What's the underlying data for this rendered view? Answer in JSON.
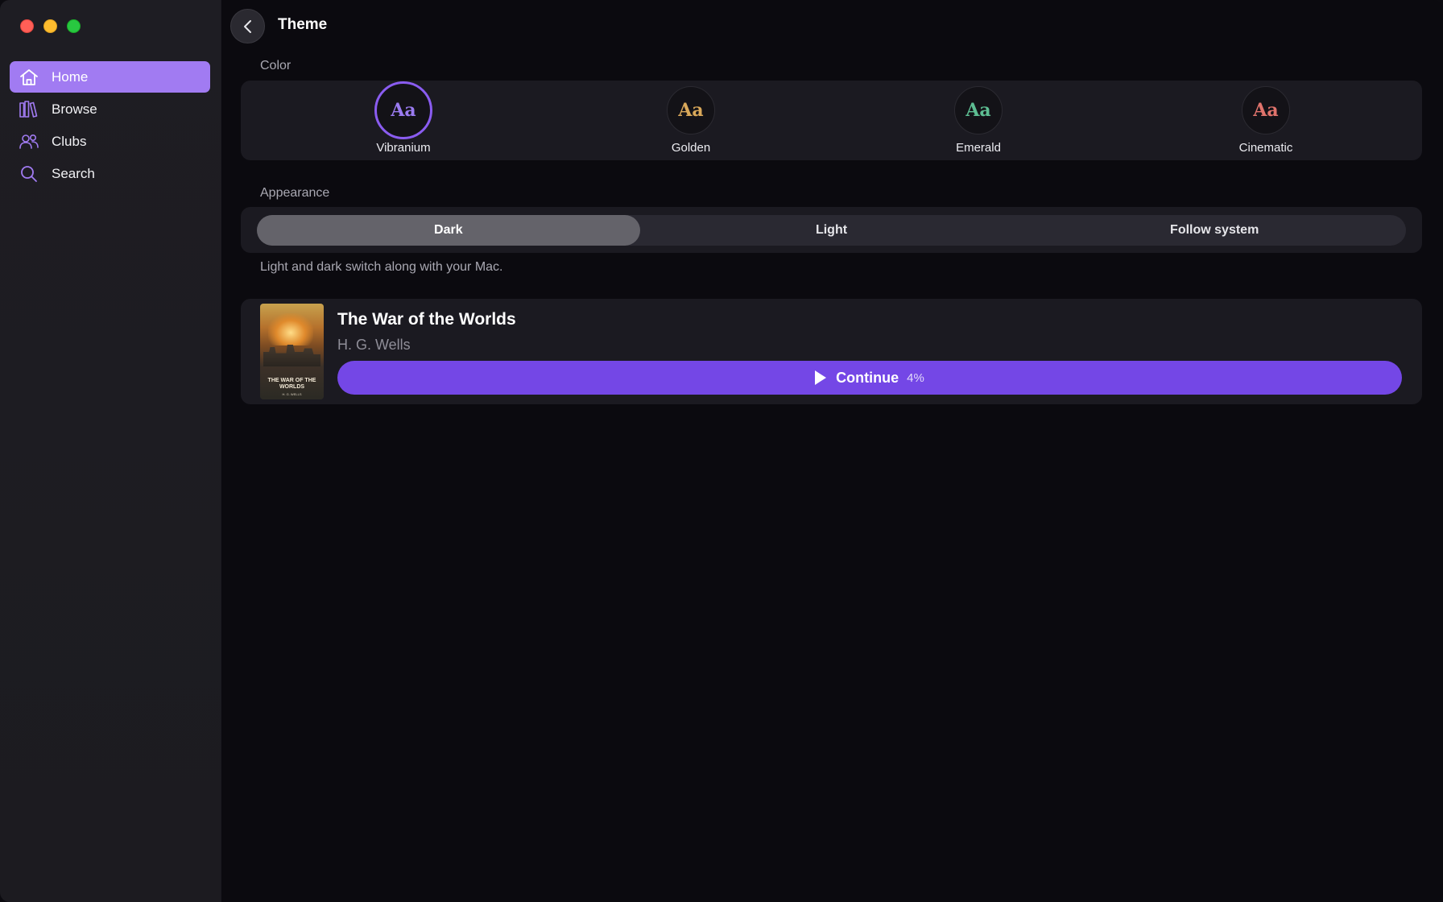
{
  "sidebar": {
    "items": [
      {
        "label": "Home",
        "icon": "home-icon",
        "active": true
      },
      {
        "label": "Browse",
        "icon": "library-icon",
        "active": false
      },
      {
        "label": "Clubs",
        "icon": "people-icon",
        "active": false
      },
      {
        "label": "Search",
        "icon": "search-icon",
        "active": false
      }
    ]
  },
  "header": {
    "title": "Theme",
    "back_icon": "chevron-left-icon"
  },
  "color_section": {
    "label": "Color",
    "swatches": [
      {
        "glyph": "Aa",
        "label": "Vibranium",
        "color": "#9a7bf0",
        "selected": true
      },
      {
        "glyph": "Aa",
        "label": "Golden",
        "color": "#d9a85a",
        "selected": false
      },
      {
        "glyph": "Aa",
        "label": "Emerald",
        "color": "#5dbd92",
        "selected": false
      },
      {
        "glyph": "Aa",
        "label": "Cinematic",
        "color": "#e0736c",
        "selected": false
      }
    ]
  },
  "appearance_section": {
    "label": "Appearance",
    "options": [
      "Dark",
      "Light",
      "Follow system"
    ],
    "selected": "Dark",
    "hint": "Light and dark switch along with your Mac."
  },
  "book": {
    "title": "The War of the Worlds",
    "author": "H. G. Wells",
    "cover_title": "THE WAR OF THE WORLDS",
    "cover_author": "H. G. WELLS",
    "continue_label": "Continue",
    "progress": "4%"
  },
  "colors": {
    "accent": "#7447e6",
    "sidebar_active": "#a17bf2"
  }
}
